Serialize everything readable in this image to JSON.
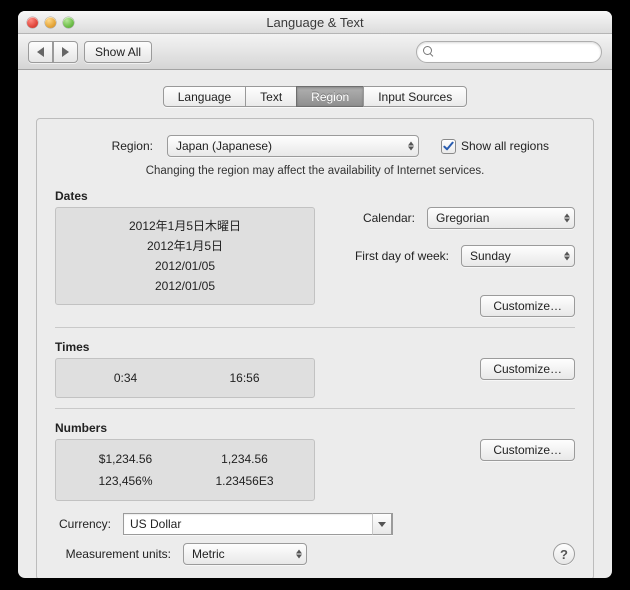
{
  "window": {
    "title": "Language & Text"
  },
  "toolbar": {
    "show_all": "Show All",
    "search_placeholder": ""
  },
  "tabs": {
    "items": [
      {
        "label": "Language",
        "selected": false
      },
      {
        "label": "Text",
        "selected": false
      },
      {
        "label": "Region",
        "selected": true
      },
      {
        "label": "Input Sources",
        "selected": false
      }
    ]
  },
  "region": {
    "label": "Region:",
    "value": "Japan (Japanese)",
    "show_all_label": "Show all regions",
    "show_all_checked": true,
    "note": "Changing the region may affect the availability of Internet services."
  },
  "dates": {
    "title": "Dates",
    "samples": [
      "2012年1月5日木曜日",
      "2012年1月5日",
      "2012/01/05",
      "2012/01/05"
    ],
    "calendar_label": "Calendar:",
    "calendar_value": "Gregorian",
    "firstday_label": "First day of week:",
    "firstday_value": "Sunday",
    "customize": "Customize…"
  },
  "times": {
    "title": "Times",
    "samples": [
      "0:34",
      "16:56"
    ],
    "customize": "Customize…"
  },
  "numbers": {
    "title": "Numbers",
    "row1": [
      "$1,234.56",
      "1,234.56"
    ],
    "row2": [
      "123,456%",
      "1.23456E3"
    ],
    "customize": "Customize…"
  },
  "currency": {
    "label": "Currency:",
    "value": "US Dollar"
  },
  "measurement": {
    "label": "Measurement units:",
    "value": "Metric"
  },
  "help_glyph": "?"
}
